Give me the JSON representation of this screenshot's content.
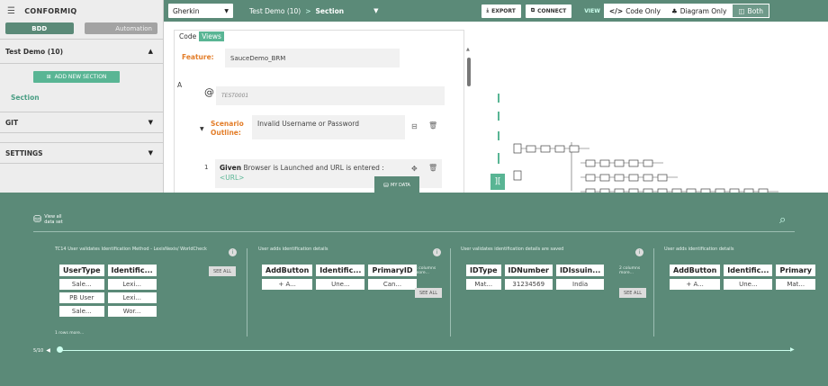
{
  "app": {
    "logo": "CONFORMIQ"
  },
  "sidebar": {
    "tabs": [
      "BDD",
      "Automation"
    ],
    "suite_title": "Test Demo (10)",
    "add_section_label": "ADD NEW SECTION",
    "section_link": "Section",
    "git_label": "GIT",
    "settings_label": "SETTINGS"
  },
  "topbar": {
    "language_select": "Gherkin",
    "breadcrumb_suite": "Test Demo (10)",
    "breadcrumb_sep": ">",
    "breadcrumb_section": "Section",
    "export_label": "EXPORT",
    "connect_label": "CONNECT",
    "view_label": "VIEW",
    "view_options": [
      "Code Only",
      "Diagram Only",
      "Both"
    ],
    "active_view": "Both"
  },
  "editor": {
    "tabs": [
      "Code",
      "Views"
    ],
    "active_tab": "Views",
    "feature_label": "Feature:",
    "feature_value": "SauceDemo_BRM",
    "a_label": "A",
    "tag_symbol": "@",
    "tag_value": "TEST0001",
    "scenario_label_1": "Scenario",
    "scenario_label_2": "Outline:",
    "scenario_value": "Invalid Username or Password",
    "step_number": "1",
    "step_keyword": "Given",
    "step_text": "Browser is Launched and URL is entered :",
    "step_param": "<URL>",
    "my_data_label": "MY DATA"
  },
  "panel": {
    "view_all_label_1": "View all",
    "view_all_label_2": "data set",
    "datasets": [
      {
        "title": "TC14 User validates Identification Method - LexisNexis/ WorldCheck",
        "headers": [
          "UserType",
          "Identific..."
        ],
        "rows": [
          [
            "Sale...",
            "Lexi..."
          ],
          [
            "PB User",
            "Lexi..."
          ],
          [
            "Sale...",
            "Wor..."
          ]
        ],
        "see_all": "SEE ALL",
        "footer": "1 rows more..."
      },
      {
        "title": "User adds identification details",
        "headers": [
          "AddButton",
          "Identific...",
          "PrimaryID"
        ],
        "rows": [
          [
            "+ A...",
            "Une...",
            "Can..."
          ]
        ],
        "see_all": "SEE ALL",
        "more_1": "4 columns",
        "more_2": "more..."
      },
      {
        "title": "User validates identification details are saved",
        "headers": [
          "IDType",
          "IDNumber",
          "IDIssuin..."
        ],
        "rows": [
          [
            "Mat...",
            "31234569",
            "India"
          ]
        ],
        "see_all": "SEE ALL",
        "more_1": "2 columns",
        "more_2": "more..."
      },
      {
        "title": "User adds identification details",
        "headers": [
          "AddButton",
          "Identific...",
          "Primary"
        ],
        "rows": [
          [
            "+ A...",
            "Une...",
            "Mat..."
          ]
        ]
      }
    ],
    "pager": "5/10"
  },
  "icons": [
    "menu-icon",
    "export-icon",
    "connect-icon",
    "code-icon",
    "diagram-icon",
    "both-icon",
    "tag-icon",
    "note-icon",
    "trash-icon",
    "move-icon",
    "database-icon",
    "search-icon",
    "info-icon",
    "expand-icon"
  ],
  "colors": {
    "primary": "#5b8a78",
    "accent": "#59b594",
    "orange": "#e37e2a"
  }
}
